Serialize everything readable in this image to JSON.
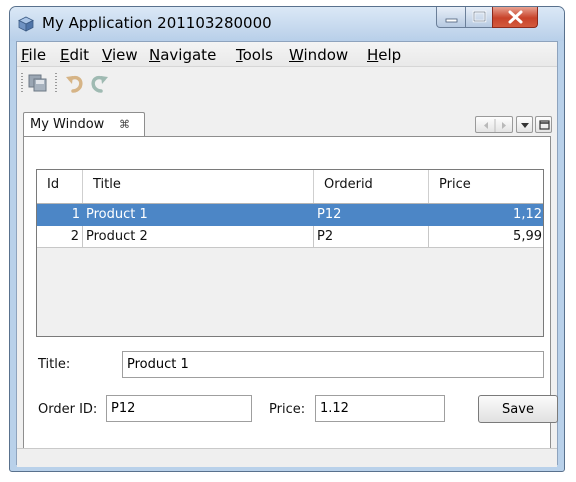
{
  "window": {
    "title": "My Application 201103280000"
  },
  "menu": [
    "File",
    "Edit",
    "View",
    "Navigate",
    "Tools",
    "Window",
    "Help"
  ],
  "toolbar": {
    "icons": [
      "save-all-icon",
      "undo-icon",
      "redo-icon"
    ]
  },
  "tab": {
    "label": "My Window",
    "close_glyph": "⌘"
  },
  "table": {
    "columns": [
      "Id",
      "Title",
      "Orderid",
      "Price"
    ],
    "rows": [
      {
        "id": "1",
        "title": "Product 1",
        "orderid": "P12",
        "price": "1,12",
        "selected": true
      },
      {
        "id": "2",
        "title": "Product 2",
        "orderid": "P2",
        "price": "5,99",
        "selected": false
      }
    ]
  },
  "form": {
    "title_label": "Title:",
    "title_value": "Product 1",
    "orderid_label": "Order ID:",
    "orderid_value": "P12",
    "price_label": "Price:",
    "price_value": "1.12",
    "save_label": "Save"
  },
  "colors": {
    "selection": "#4c86c6",
    "window_frame": "#b9d1ea",
    "close_button": "#c8432a"
  }
}
